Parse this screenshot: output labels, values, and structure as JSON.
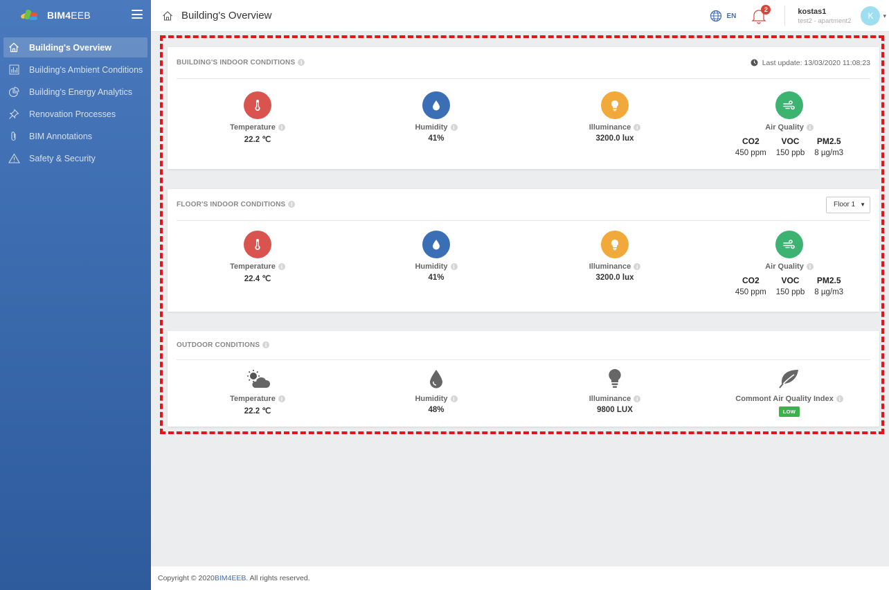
{
  "app": {
    "brand_bold": "BIM4",
    "brand_thin": "EEB",
    "page_title": "Building's Overview"
  },
  "sidebar": {
    "items": [
      {
        "label": "Building's Overview",
        "icon": "home-icon",
        "active": true
      },
      {
        "label": "Building's Ambient Conditions",
        "icon": "bar-chart-icon",
        "active": false
      },
      {
        "label": "Building's Energy Analytics",
        "icon": "pie-chart-icon",
        "active": false
      },
      {
        "label": "Renovation Processes",
        "icon": "pin-icon",
        "active": false
      },
      {
        "label": "BIM Annotations",
        "icon": "clip-icon",
        "active": false
      },
      {
        "label": "Safety & Security",
        "icon": "warning-icon",
        "active": false
      }
    ]
  },
  "topbar": {
    "language": "EN",
    "notifications": "2",
    "user_name": "kostas1",
    "user_sub": "test2 - apartment2",
    "avatar_initial": "K"
  },
  "building": {
    "title": "BUILDING'S INDOOR CONDITIONS",
    "last_update": "Last update: 13/03/2020 11:08:23",
    "temperature": {
      "label": "Temperature",
      "value": "22.2 ℃"
    },
    "humidity": {
      "label": "Humidity",
      "value": "41%"
    },
    "illuminance": {
      "label": "Illuminance",
      "value": "3200.0 lux"
    },
    "air_quality": {
      "label": "Air Quality",
      "co2_label": "CO2",
      "co2_value": "450 ppm",
      "voc_label": "VOC",
      "voc_value": "150 ppb",
      "pm_label": "PM2.5",
      "pm_value": "8 µg/m3"
    }
  },
  "floor": {
    "title": "FLOOR'S INDOOR CONDITIONS",
    "selected_floor": "Floor 1",
    "temperature": {
      "label": "Temperature",
      "value": "22.4 ℃"
    },
    "humidity": {
      "label": "Humidity",
      "value": "41%"
    },
    "illuminance": {
      "label": "Illuminance",
      "value": "3200.0 lux"
    },
    "air_quality": {
      "label": "Air Quality",
      "co2_label": "CO2",
      "co2_value": "450 ppm",
      "voc_label": "VOC",
      "voc_value": "150 ppb",
      "pm_label": "PM2.5",
      "pm_value": "8 µg/m3"
    }
  },
  "outdoor": {
    "title": "OUTDOOR CONDITIONS",
    "temperature": {
      "label": "Temperature",
      "value": "22.2 ℃"
    },
    "humidity": {
      "label": "Humidity",
      "value": "48%"
    },
    "illuminance": {
      "label": "Illuminance",
      "value": "9800 LUX"
    },
    "aqi": {
      "label": "Commont Air Quality Index",
      "value": "LOW"
    }
  },
  "footer": {
    "prefix": "Copyright © 2020 ",
    "link": "BIM4EEB",
    "suffix": ". All rights reserved."
  },
  "colors": {
    "temperature": "#d9534f",
    "humidity": "#3b6fb5",
    "illuminance": "#f2a93b",
    "air_quality": "#3cb371",
    "highlight": "#e4141b"
  }
}
